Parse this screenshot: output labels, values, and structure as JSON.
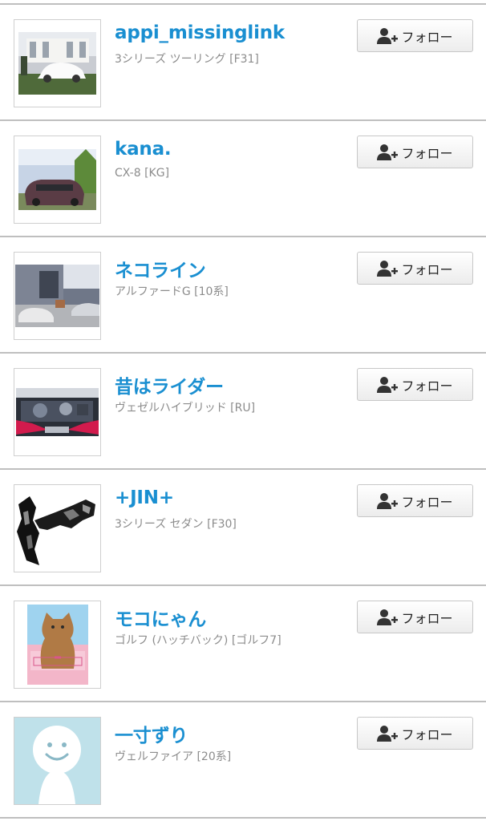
{
  "follow_label": "フォロー",
  "colors": {
    "name": "#1a8fd1",
    "car": "#8c8c8c",
    "divider": "#bfbfbf"
  },
  "users": [
    {
      "name": "appi_missinglink",
      "car": "3シリーズ ツーリング [F31]",
      "icon": "white-car-photo"
    },
    {
      "name": "kana.",
      "car": "CX-8 [KG]",
      "icon": "red-suv-photo"
    },
    {
      "name": "ネコライン",
      "car": "アルファードG [10系]",
      "icon": "house-cars-photo"
    },
    {
      "name": "昔はライダー",
      "car": "ヴェゼルハイブリッド [RU]",
      "icon": "engine-bay-photo"
    },
    {
      "name": "+JIN+",
      "car": "3シリーズ セダン [F30]",
      "icon": "black-creature-art"
    },
    {
      "name": "モコにゃん",
      "car": "ゴルフ (ハッチバック) [ゴルフ7]",
      "icon": "cat-photo"
    },
    {
      "name": "一寸ずり",
      "car": "ヴェルファイア [20系]",
      "icon": "default-avatar"
    }
  ]
}
